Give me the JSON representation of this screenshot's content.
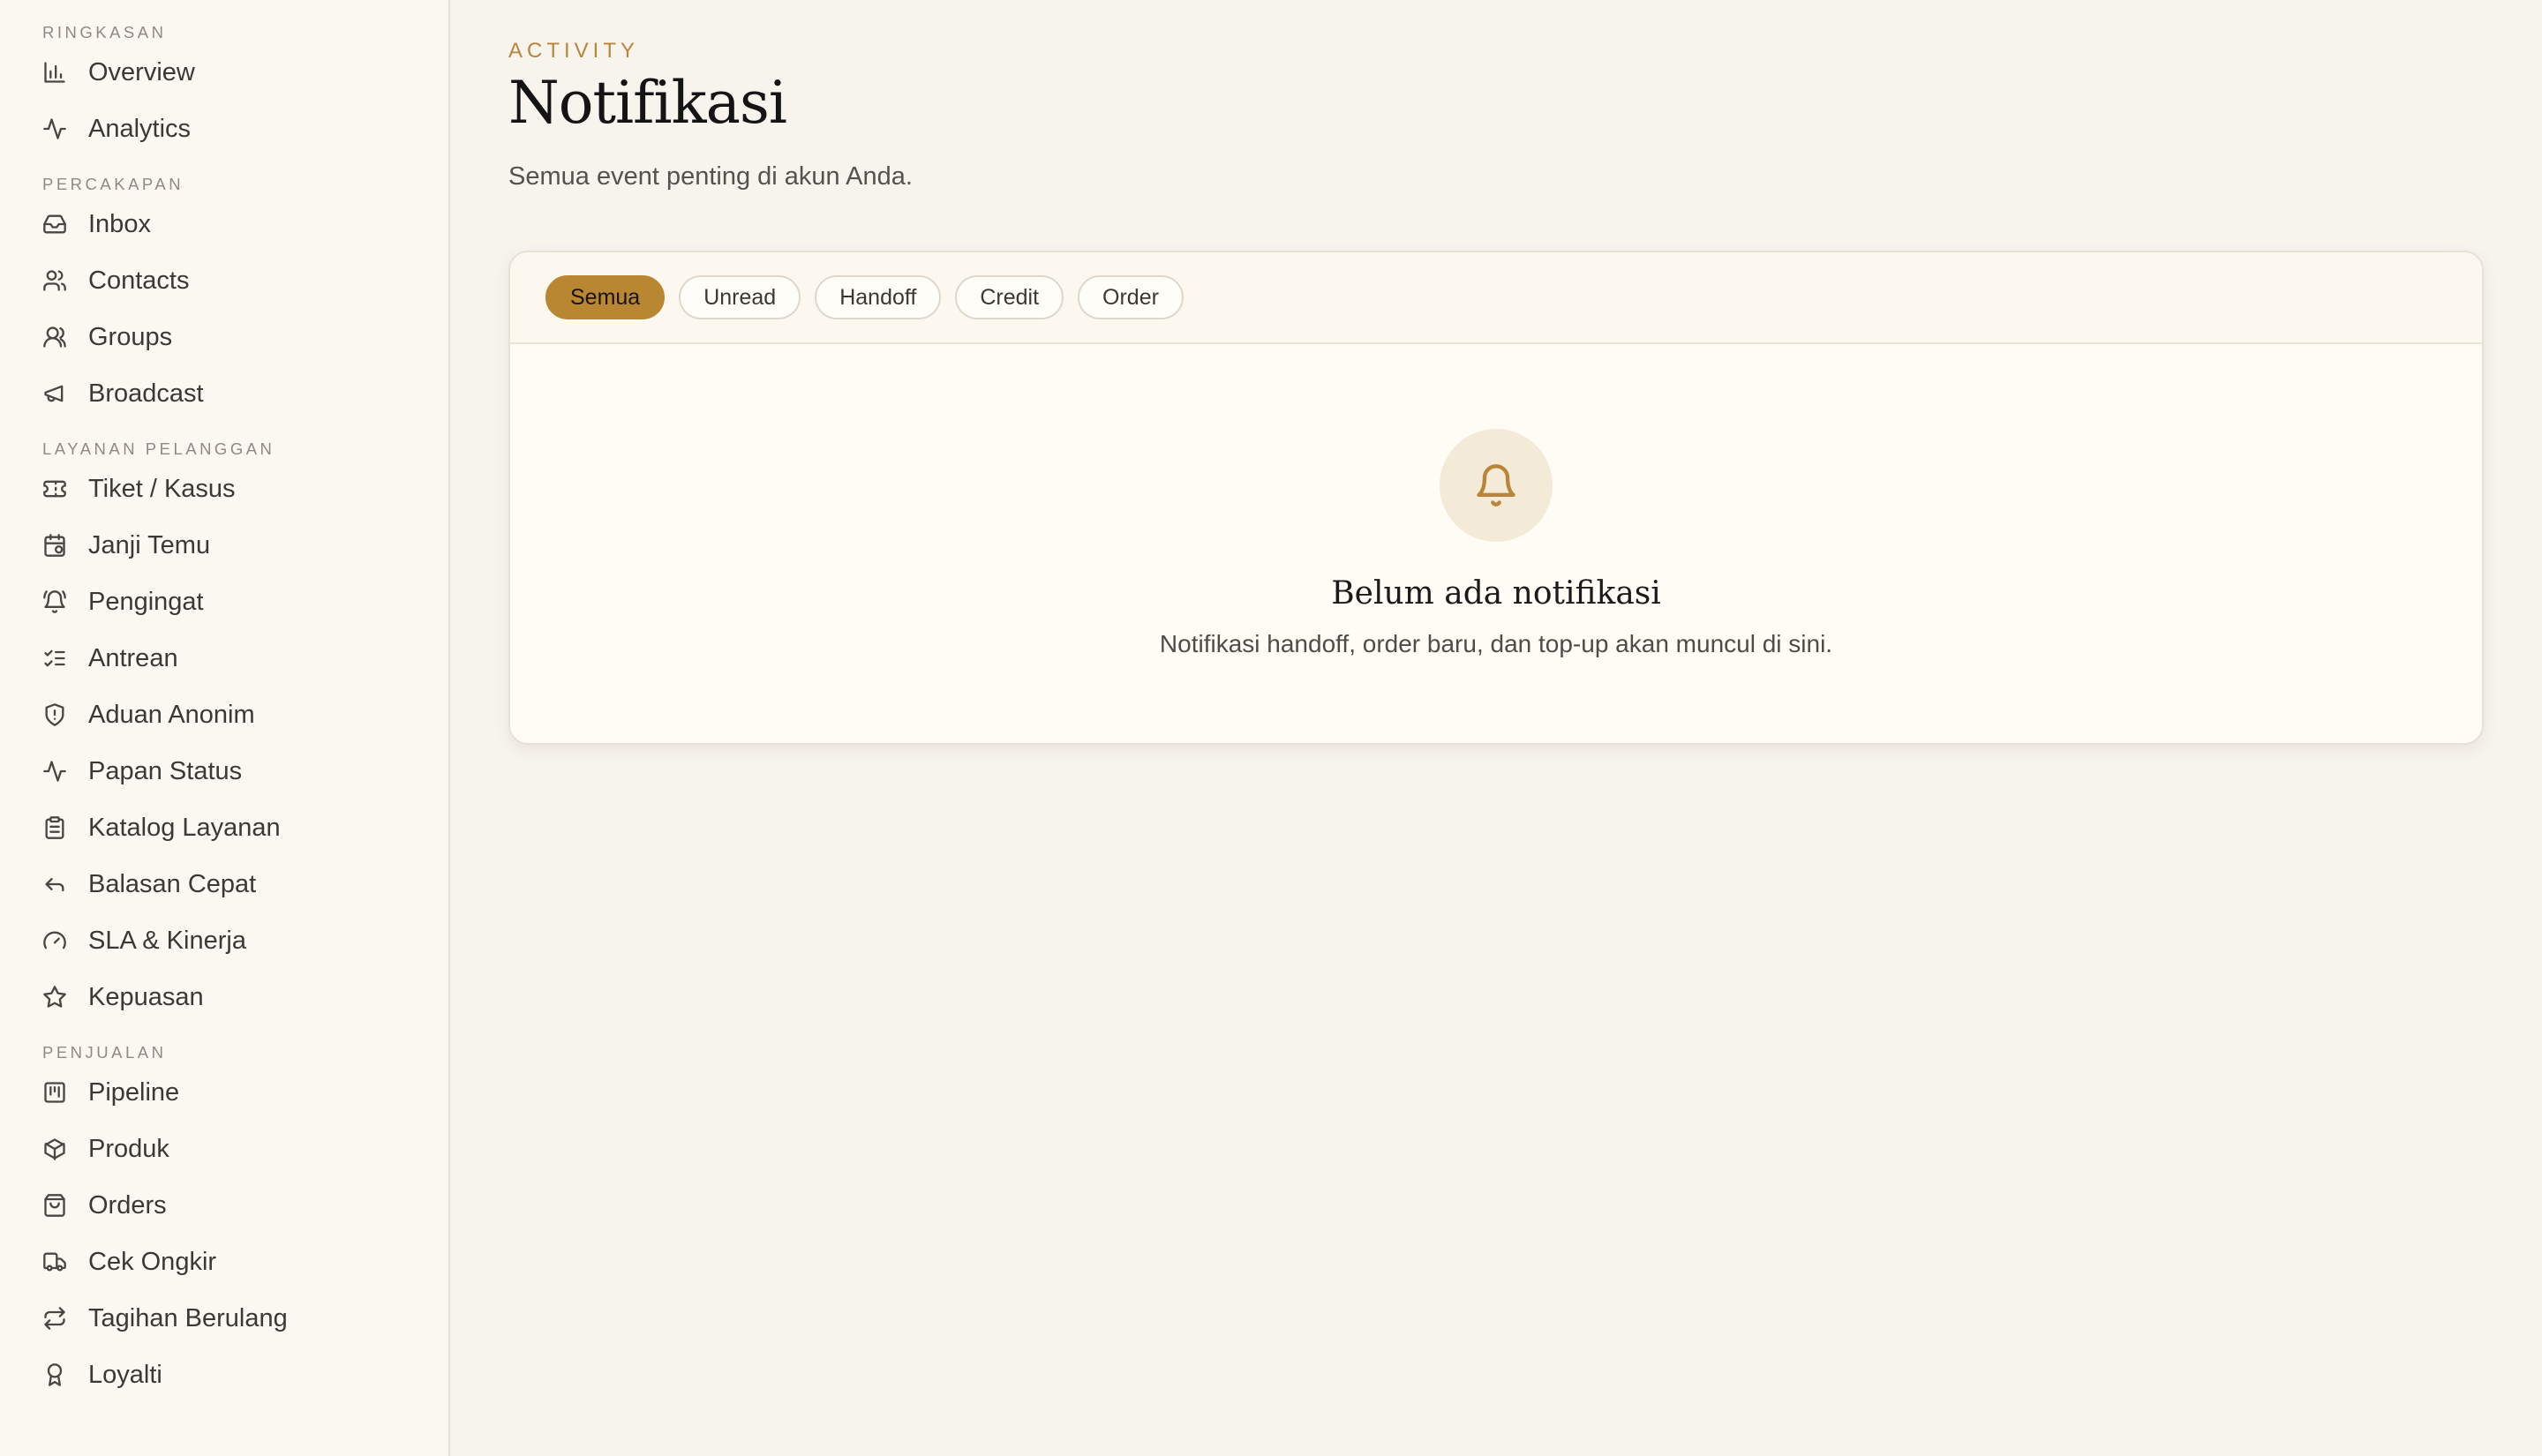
{
  "sidebar": {
    "sections": [
      {
        "label": "RINGKASAN",
        "items": [
          {
            "label": "Overview",
            "icon": "bar-chart-icon"
          },
          {
            "label": "Analytics",
            "icon": "activity-icon"
          }
        ]
      },
      {
        "label": "PERCAKAPAN",
        "items": [
          {
            "label": "Inbox",
            "icon": "inbox-icon"
          },
          {
            "label": "Contacts",
            "icon": "users-icon"
          },
          {
            "label": "Groups",
            "icon": "group-icon"
          },
          {
            "label": "Broadcast",
            "icon": "megaphone-icon"
          }
        ]
      },
      {
        "label": "LAYANAN PELANGGAN",
        "items": [
          {
            "label": "Tiket / Kasus",
            "icon": "ticket-icon"
          },
          {
            "label": "Janji Temu",
            "icon": "calendar-clock-icon"
          },
          {
            "label": "Pengingat",
            "icon": "bell-ring-icon"
          },
          {
            "label": "Antrean",
            "icon": "list-checks-icon"
          },
          {
            "label": "Aduan Anonim",
            "icon": "shield-icon"
          },
          {
            "label": "Papan Status",
            "icon": "activity-icon"
          },
          {
            "label": "Katalog Layanan",
            "icon": "clipboard-icon"
          },
          {
            "label": "Balasan Cepat",
            "icon": "reply-icon"
          },
          {
            "label": "SLA & Kinerja",
            "icon": "gauge-icon"
          },
          {
            "label": "Kepuasan",
            "icon": "star-icon"
          }
        ]
      },
      {
        "label": "PENJUALAN",
        "items": [
          {
            "label": "Pipeline",
            "icon": "kanban-icon"
          },
          {
            "label": "Produk",
            "icon": "package-icon"
          },
          {
            "label": "Orders",
            "icon": "shopping-bag-icon"
          },
          {
            "label": "Cek Ongkir",
            "icon": "truck-icon"
          },
          {
            "label": "Tagihan Berulang",
            "icon": "repeat-icon"
          },
          {
            "label": "Loyalti",
            "icon": "award-icon"
          }
        ]
      }
    ]
  },
  "header": {
    "eyebrow": "ACTIVITY",
    "title": "Notifikasi",
    "subtitle": "Semua event penting di akun Anda."
  },
  "filters": {
    "tabs": [
      "Semua",
      "Unread",
      "Handoff",
      "Credit",
      "Order"
    ],
    "active": "Semua"
  },
  "empty_state": {
    "icon": "bell-icon",
    "title": "Belum ada notifikasi",
    "description": "Notifikasi handoff, order baru, dan top-up akan muncul di sini."
  },
  "colors": {
    "accent": "#b98732",
    "background": "#f7f4ee",
    "sidebar": "#fbf8f2",
    "card": "#fffcf5"
  }
}
